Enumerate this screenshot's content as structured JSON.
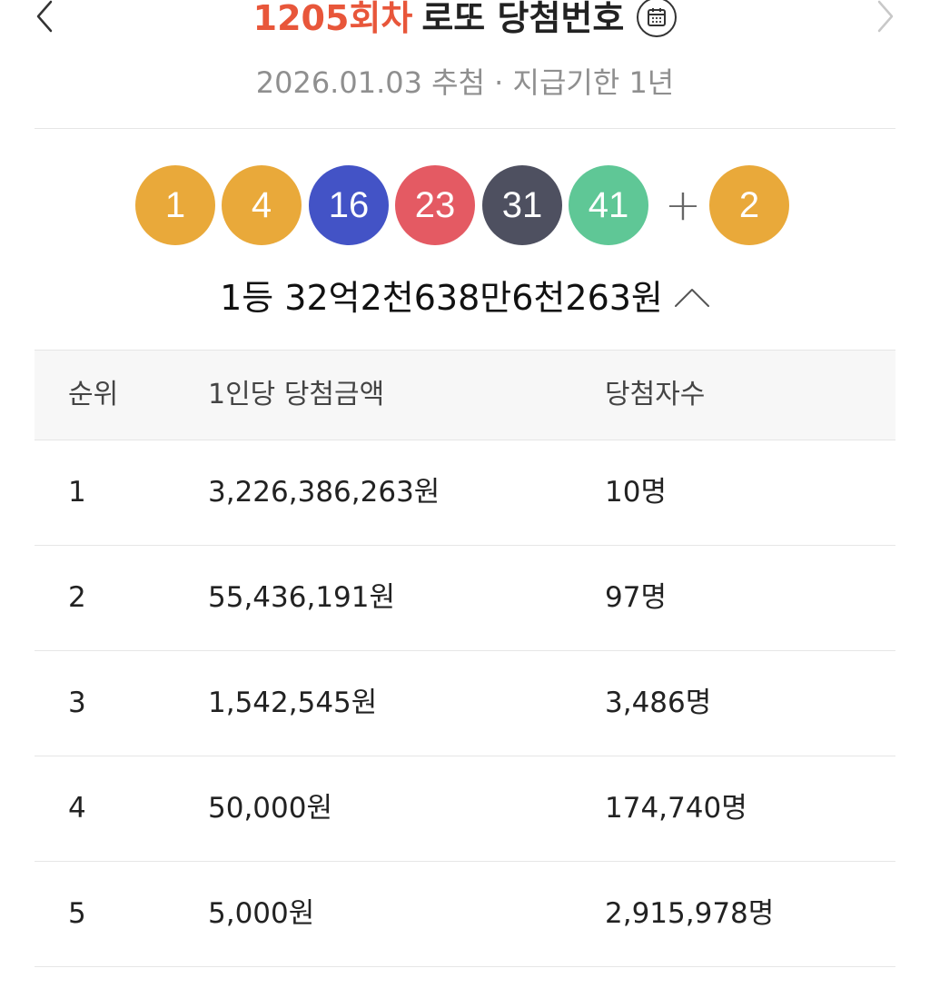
{
  "header": {
    "round_number": "1205회차",
    "title": "로또 당첨번호",
    "subtitle": "2026.01.03 추첨 · 지급기한 1년",
    "prev_icon": "chevron-left-icon",
    "next_icon": "chevron-right-icon",
    "calendar_icon": "calendar-icon"
  },
  "draw": {
    "numbers": [
      {
        "value": "1",
        "color": "#e9a93a"
      },
      {
        "value": "4",
        "color": "#e9a93a"
      },
      {
        "value": "16",
        "color": "#4353c6"
      },
      {
        "value": "23",
        "color": "#e45a63"
      },
      {
        "value": "31",
        "color": "#4e5060"
      },
      {
        "value": "41",
        "color": "#5fc796"
      }
    ],
    "plus": "+",
    "bonus": {
      "value": "2",
      "color": "#e9a93a"
    }
  },
  "first_prize_summary": "1등 32억2천638만6천263원",
  "table": {
    "headers": {
      "rank": "순위",
      "amount": "1인당 당첨금액",
      "winners": "당첨자수"
    },
    "rows": [
      {
        "rank": "1",
        "amount": "3,226,386,263원",
        "winners": "10명"
      },
      {
        "rank": "2",
        "amount": "55,436,191원",
        "winners": "97명"
      },
      {
        "rank": "3",
        "amount": "1,542,545원",
        "winners": "3,486명"
      },
      {
        "rank": "4",
        "amount": "50,000원",
        "winners": "174,740명"
      },
      {
        "rank": "5",
        "amount": "5,000원",
        "winners": "2,915,978명"
      }
    ]
  }
}
